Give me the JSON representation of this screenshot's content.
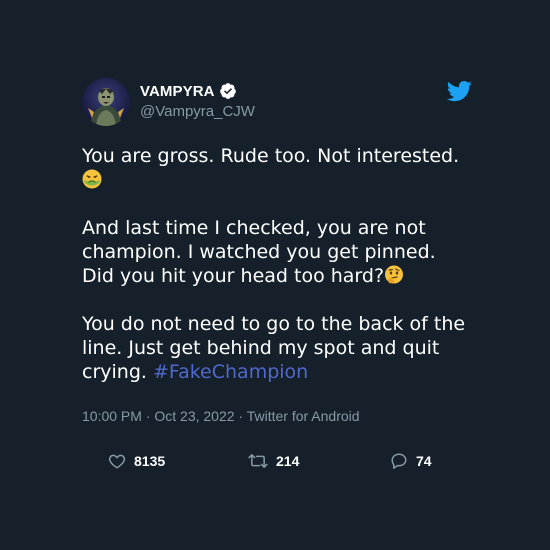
{
  "tweet": {
    "display_name": "VAMPYRA",
    "handle": "@Vampyra_CJW",
    "paragraph1": "You are gross. Rude too. Not interested.",
    "paragraph2": "And last time I checked, you are not champion. I watched you get pinned. Did you hit your head too hard?",
    "paragraph3": "You do not need to go to the back of the line. Just get behind my spot and quit crying.",
    "hashtag": "#FakeChampion",
    "timestamp": "10:00 PM · Oct 23, 2022 · Twitter for Android",
    "emoji1": "nauseated-face",
    "emoji2": "thinking-face"
  },
  "stats": {
    "likes": "8135",
    "retweets": "214",
    "replies": "74"
  },
  "icons": {
    "logo": "twitter-bird-icon",
    "verified": "verified-badge-icon",
    "like": "heart-icon",
    "retweet": "retweet-icon",
    "reply": "reply-bubble-icon"
  },
  "colors": {
    "background": "#15202b",
    "accent": "#1da1f2",
    "hashtag": "#4f68cc",
    "secondary_text": "#8899a6"
  }
}
